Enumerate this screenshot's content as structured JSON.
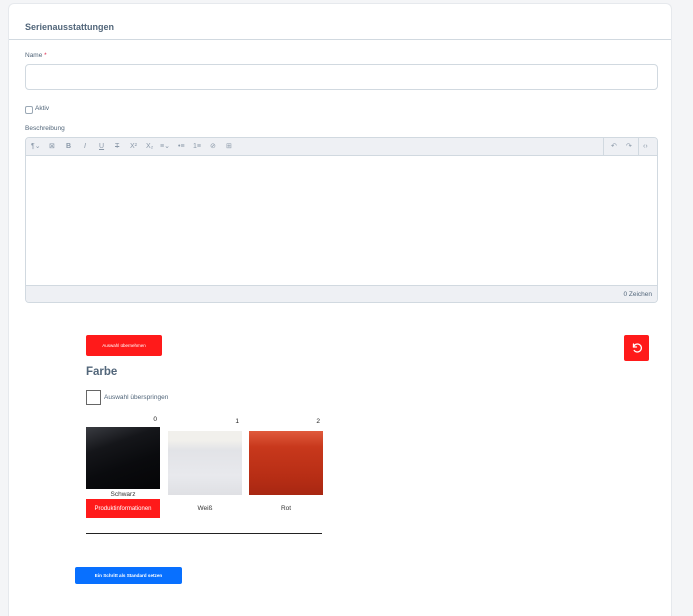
{
  "card": {
    "title": "Serienausstattungen"
  },
  "form": {
    "name_label": "Name",
    "name_required": "*",
    "name_value": "",
    "active_label": "Aktiv",
    "description_label": "Beschreibung",
    "char_count": "0 Zeichen"
  },
  "toolbar": {
    "icons": [
      "paragraph-icon",
      "clear-format-icon",
      "bold-icon",
      "italic-icon",
      "underline-icon",
      "strikethrough-icon",
      "superscript-icon",
      "subscript-icon",
      "align-icon",
      "bullet-list-icon",
      "numbered-list-icon",
      "link-icon",
      "table-icon",
      "undo-icon",
      "redo-icon",
      "code-view-icon"
    ]
  },
  "configurator": {
    "apply_label": "Auswahl übernehmen",
    "section_title": "Farbe",
    "skip_label": "Auswahl überspringen",
    "swatches": [
      {
        "index": "0",
        "name": "Schwarz",
        "color": "#0a0b0e"
      },
      {
        "index": "1",
        "name": "Weiß",
        "color": "#e6e7eb"
      },
      {
        "index": "2",
        "name": "Rot",
        "color": "#c0321a"
      }
    ],
    "info_label": "Produktinformationen",
    "default_label": "Ein Schritt als Standard setzen"
  },
  "colors": {
    "accent_red": "#ff1a1a",
    "primary_blue": "#0870ff"
  }
}
